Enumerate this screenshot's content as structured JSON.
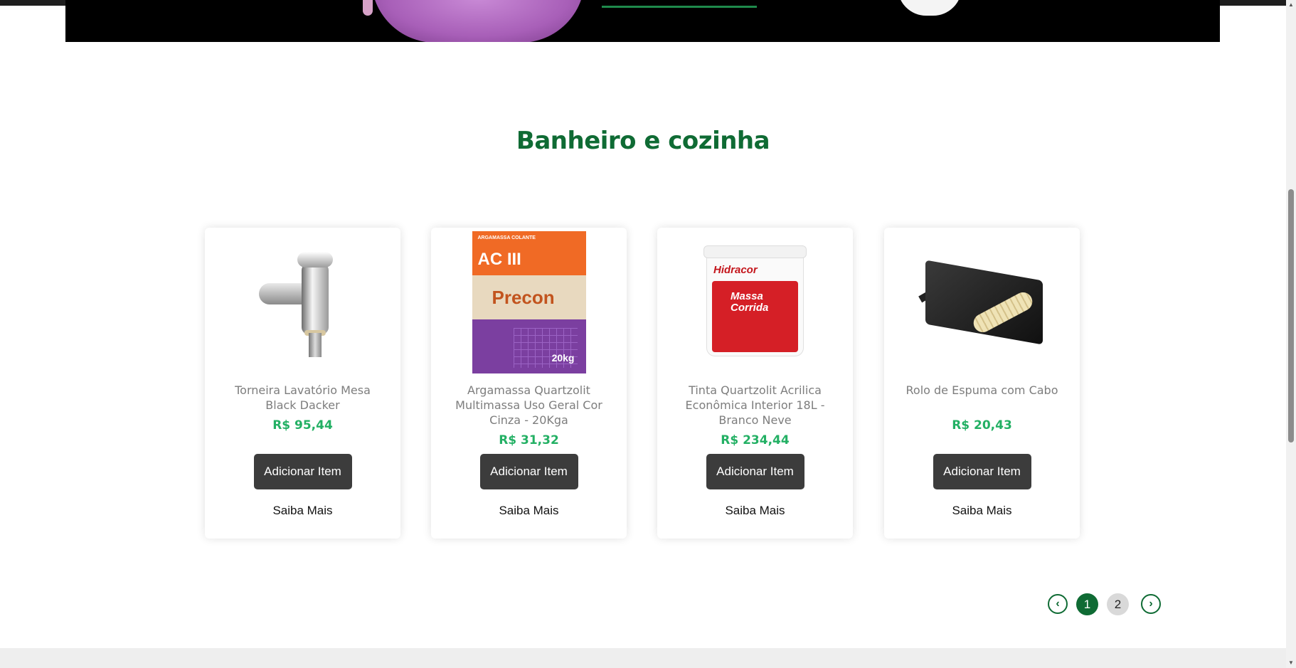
{
  "section": {
    "title": "Banheiro e cozinha"
  },
  "products": [
    {
      "name": "Torneira Lavatório Mesa Black Dacker",
      "price": "R$ 95,44",
      "add_label": "Adicionar Item",
      "more_label": "Saiba Mais",
      "image_icon": "faucet-image"
    },
    {
      "name": "Argamassa Quartzolit Multimassa Uso Geral Cor Cinza - 20Kga",
      "price": "R$ 31,32",
      "add_label": "Adicionar Item",
      "more_label": "Saiba Mais",
      "image_icon": "mortar-bag-image",
      "image_text": {
        "top": "ARGAMASSA COLANTE",
        "code": "AC III",
        "brand": "Precon",
        "weight": "20kg"
      }
    },
    {
      "name": "Tinta Quartzolit Acrilica Econômica Interior 18L - Branco Neve",
      "price": "R$ 234,44",
      "add_label": "Adicionar Item",
      "more_label": "Saiba Mais",
      "image_icon": "paint-bucket-image",
      "image_text": {
        "brand": "Hidracor",
        "product": "Massa Corrida"
      }
    },
    {
      "name": "Rolo de Espuma com Cabo",
      "price": "R$ 20,43",
      "add_label": "Adicionar Item",
      "more_label": "Saiba Mais",
      "image_icon": "paint-roller-tray-image"
    }
  ],
  "pagination": {
    "prev_icon": "chevron-left-icon",
    "next_icon": "chevron-right-icon",
    "pages": [
      "1",
      "2"
    ],
    "current": "1"
  },
  "colors": {
    "title_green": "#0f6b34",
    "price_green": "#23b064",
    "button_dark": "#3c3c3c"
  }
}
